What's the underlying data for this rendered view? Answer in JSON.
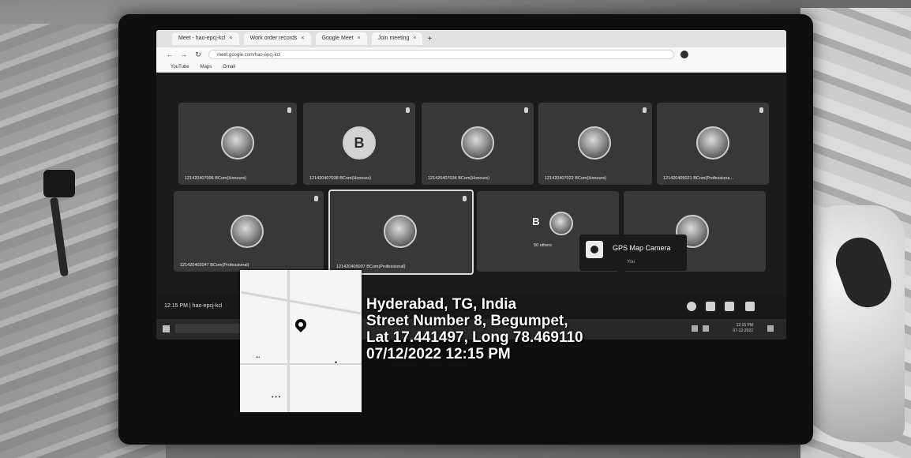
{
  "browser": {
    "tabs": [
      {
        "label": "Meet - hao-epcj-kcl"
      },
      {
        "label": "Work order records"
      },
      {
        "label": "Google Meet"
      },
      {
        "label": "Join meeting"
      }
    ],
    "url": "meet.google.com/hao-epcj-kcl",
    "bookmarks": [
      "YouTube",
      "Maps",
      "Gmail"
    ]
  },
  "participants": [
    {
      "name": "121420407096 BCom(Honours)",
      "avatar": "photo"
    },
    {
      "name": "121420407038 BCom(Honours)",
      "avatar": "letter",
      "letter": "B"
    },
    {
      "name": "121420407034 BCom(Honours)",
      "avatar": "photo"
    },
    {
      "name": "121420407022 BCom(Honours)",
      "avatar": "photo"
    },
    {
      "name": "121420405021 BCom(Professiona...",
      "avatar": "photo"
    },
    {
      "name": "121420402047 BCom(Professional)",
      "avatar": "photo"
    },
    {
      "name": "121420405007 BCom(Professional)",
      "avatar": "photo",
      "selected": true
    },
    {
      "name": "50 others",
      "avatar": "letter",
      "letter": "B"
    },
    {
      "name": "",
      "avatar": "photo"
    }
  ],
  "popup": {
    "title": "GPS Map Camera",
    "subtitle": "You"
  },
  "meeting_bar": {
    "time": "12:15 PM | hao-epcj-kcl"
  },
  "taskbar": {
    "time": "12:15 PM",
    "date": "07-12-2022"
  },
  "gps": {
    "city": "Hyderabad, TG, India",
    "street": "Street Number 8, Begumpet,",
    "coords": "Lat 17.441497, Long 78.469110",
    "datetime": "07/12/2022 12:15 PM"
  }
}
